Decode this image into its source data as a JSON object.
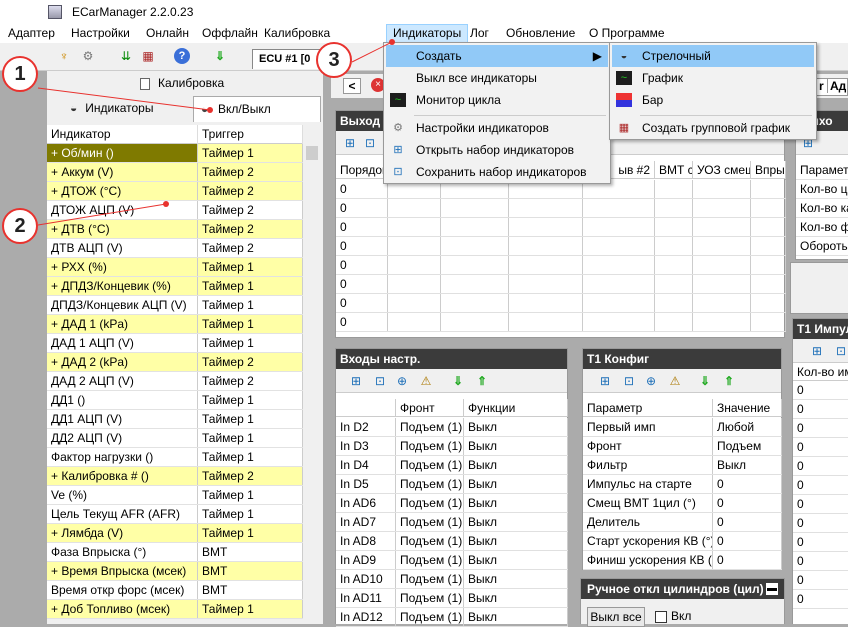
{
  "app": {
    "title": "ECarManager 2.2.0.23"
  },
  "menu": [
    "Адаптер",
    "Настройки",
    "Онлайн",
    "Оффлайн",
    "Калибровка",
    "Индикаторы",
    "Лог",
    "Обновление",
    "О Программе"
  ],
  "toolbar": {
    "ecu_tab": "ECU #1 [0"
  },
  "left": {
    "tab_calibration": "Калибровка",
    "tab_indicators": "Индикаторы",
    "toggle_label": "Вкл/Выкл",
    "columns": [
      "Индикатор",
      "Триггер"
    ],
    "rows": [
      {
        "name": "+ Об/мин ()",
        "trigger": "Таймер 1",
        "style": "sel"
      },
      {
        "name": "+ Аккум (V)",
        "trigger": "Таймер 2",
        "style": "y"
      },
      {
        "name": "+ ДТОЖ (°С)",
        "trigger": "Таймер 2",
        "style": "y"
      },
      {
        "name": "ДТОЖ АЦП (V)",
        "trigger": "Таймер 2",
        "style": "w"
      },
      {
        "name": "+ ДТВ (°С)",
        "trigger": "Таймер 2",
        "style": "y"
      },
      {
        "name": "ДТВ АЦП (V)",
        "trigger": "Таймер 2",
        "style": "w"
      },
      {
        "name": "+ РХХ (%)",
        "trigger": "Таймер 1",
        "style": "y"
      },
      {
        "name": "+ ДПДЗ/Концевик (%)",
        "trigger": "Таймер 1",
        "style": "y"
      },
      {
        "name": "ДПДЗ/Концевик АЦП (V)",
        "trigger": "Таймер 1",
        "style": "w"
      },
      {
        "name": "+ ДАД 1 (kPa)",
        "trigger": "Таймер 1",
        "style": "y"
      },
      {
        "name": "ДАД 1 АЦП (V)",
        "trigger": "Таймер 1",
        "style": "w"
      },
      {
        "name": "+ ДАД 2 (kPa)",
        "trigger": "Таймер 2",
        "style": "y"
      },
      {
        "name": "ДАД 2 АЦП (V)",
        "trigger": "Таймер 2",
        "style": "w"
      },
      {
        "name": "ДД1 ()",
        "trigger": "Таймер 1",
        "style": "w"
      },
      {
        "name": "ДД1 АЦП (V)",
        "trigger": "Таймер 1",
        "style": "w"
      },
      {
        "name": "ДД2 АЦП (V)",
        "trigger": "Таймер 1",
        "style": "w"
      },
      {
        "name": "Фактор нагрузки ()",
        "trigger": "Таймер 1",
        "style": "w"
      },
      {
        "name": "+ Калибровка # ()",
        "trigger": "Таймер 2",
        "style": "y"
      },
      {
        "name": "Ve (%)",
        "trigger": "Таймер 1",
        "style": "w"
      },
      {
        "name": "Цель Текущ AFR (AFR)",
        "trigger": "Таймер 1",
        "style": "w"
      },
      {
        "name": "+ Лямбда (V)",
        "trigger": "Таймер 1",
        "style": "y"
      },
      {
        "name": "Фаза Впрыска (°)",
        "trigger": "ВМТ",
        "style": "w"
      },
      {
        "name": "+ Время Впрыска (мсек)",
        "trigger": "ВМТ",
        "style": "y"
      },
      {
        "name": "Время откр форс (мсек)",
        "trigger": "ВМТ",
        "style": "w"
      },
      {
        "name": "+ Доб Топливо (мсек)",
        "trigger": "Таймер 1",
        "style": "y"
      }
    ]
  },
  "dropdown_main": [
    "Создать",
    "Выкл все индикаторы",
    "Монитор цикла",
    "Настройки индикаторов",
    "Открыть набор индикаторов",
    "Сохранить набор индикаторов"
  ],
  "dropdown_sub": [
    "Стрелочный",
    "График",
    "Бар",
    "Создать групповой график"
  ],
  "outputs": {
    "title": "Выход",
    "headers": [
      "Порядок",
      "ыв #2",
      "ВМТ с",
      "УОЗ смещ",
      "Впры"
    ],
    "values": [
      "0",
      "0",
      "0",
      "0",
      "0",
      "0",
      "0",
      "0"
    ]
  },
  "inputs": {
    "title": "Входы настр.",
    "headers": [
      "",
      "Фронт",
      "Функции"
    ],
    "rows": [
      [
        "In D2",
        "Подъем (1)",
        "Выкл"
      ],
      [
        "In D3",
        "Подъем (1)",
        "Выкл"
      ],
      [
        "In D4",
        "Подъем (1)",
        "Выкл"
      ],
      [
        "In D5",
        "Подъем (1)",
        "Выкл"
      ],
      [
        "In AD6",
        "Подъем (1)",
        "Выкл"
      ],
      [
        "In AD7",
        "Подъем (1)",
        "Выкл"
      ],
      [
        "In AD8",
        "Подъем (1)",
        "Выкл"
      ],
      [
        "In AD9",
        "Подъем (1)",
        "Выкл"
      ],
      [
        "In AD10",
        "Подъем (1)",
        "Выкл"
      ],
      [
        "In AD11",
        "Подъем (1)",
        "Выкл"
      ],
      [
        "In AD12",
        "Подъем (1)",
        "Выкл"
      ]
    ]
  },
  "t1": {
    "title": "T1 Конфиг",
    "headers": [
      "Параметр",
      "Значение"
    ],
    "rows": [
      [
        "Первый имп",
        "Любой"
      ],
      [
        "Фронт",
        "Подъем"
      ],
      [
        "Фильтр",
        "Выкл"
      ],
      [
        "Импульс на старте",
        "0"
      ],
      [
        "Смещ ВМТ 1цил (°)",
        "0"
      ],
      [
        "Делитель",
        "0"
      ],
      [
        "Старт ускорения КВ (°)",
        "0"
      ],
      [
        "Финиш ускорения КВ (°)",
        "0"
      ]
    ]
  },
  "manual": {
    "title": "Ручное откл цилиндров (цил)",
    "btn": "Выкл все",
    "chk": "Вкл"
  },
  "right_top": {
    "title": "Выхо",
    "rows": [
      "Парамет",
      "Кол-во ци",
      "Кол-во ка",
      "Кол-во фи",
      "Обороты"
    ]
  },
  "right_bottom": {
    "title": "T1 Импул",
    "header": "Кол-во им",
    "values": [
      "0",
      "0",
      "0",
      "0",
      "0",
      "0",
      "0",
      "0",
      "0",
      "0",
      "0",
      "0"
    ]
  },
  "doc_tabs": [
    "r",
    "Ад"
  ],
  "callouts": [
    "1",
    "2",
    "3"
  ]
}
